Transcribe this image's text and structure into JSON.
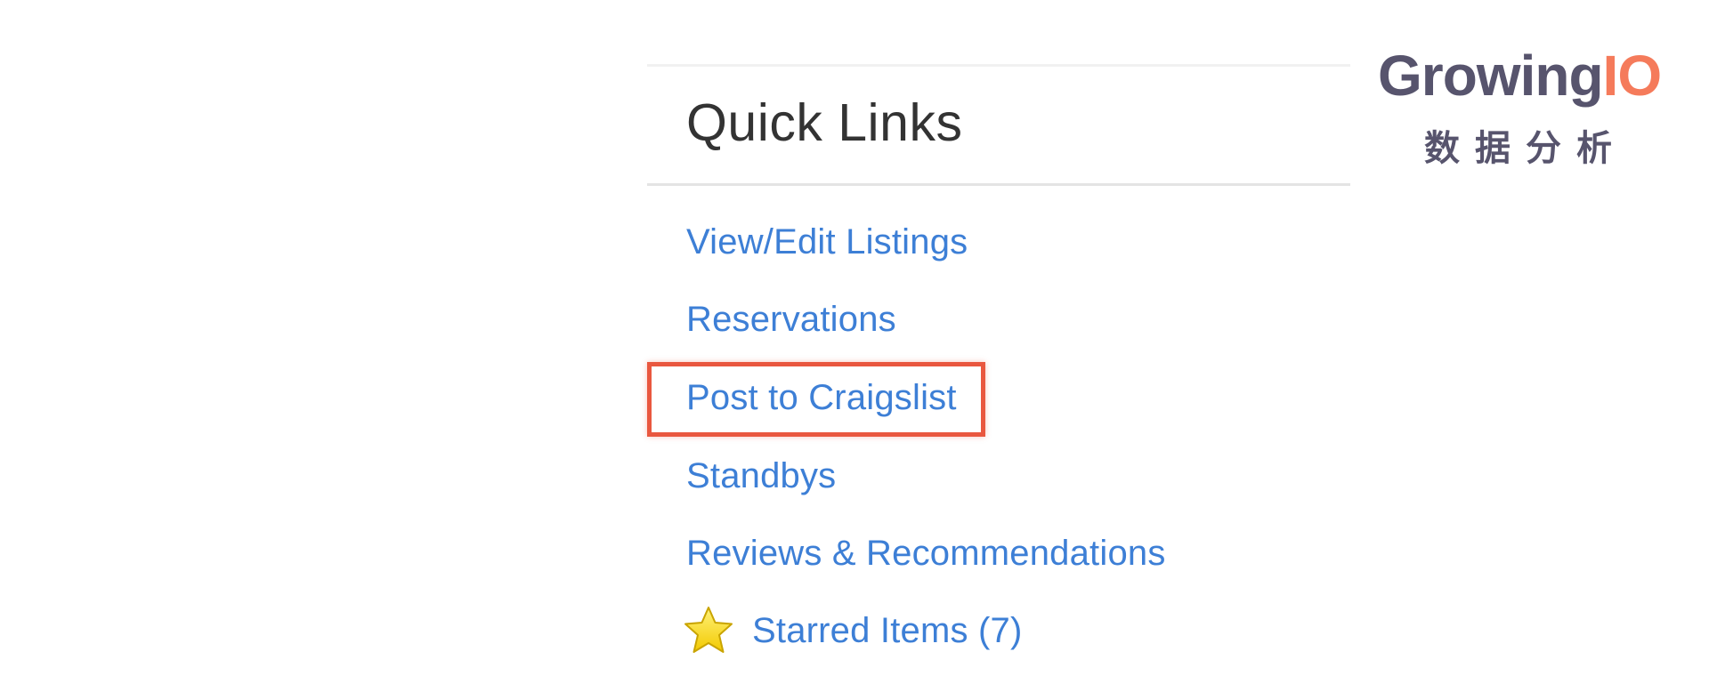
{
  "quick_links": {
    "title": "Quick Links",
    "items": [
      {
        "label": "View/Edit Listings"
      },
      {
        "label": "Reservations"
      },
      {
        "label": "Post to Craigslist",
        "highlighted": true
      },
      {
        "label": "Standbys"
      },
      {
        "label": "Reviews & Recommendations"
      },
      {
        "label": "Starred Items (7)",
        "icon": "star-icon"
      }
    ]
  },
  "logo": {
    "name_main": "Growing",
    "name_accent": "IO",
    "subtitle": "数据分析"
  },
  "colors": {
    "link": "#3d7fd6",
    "highlight_border": "#e9573f",
    "title": "#333333",
    "logo_main": "#57546d",
    "logo_accent": "#f57b5b"
  }
}
